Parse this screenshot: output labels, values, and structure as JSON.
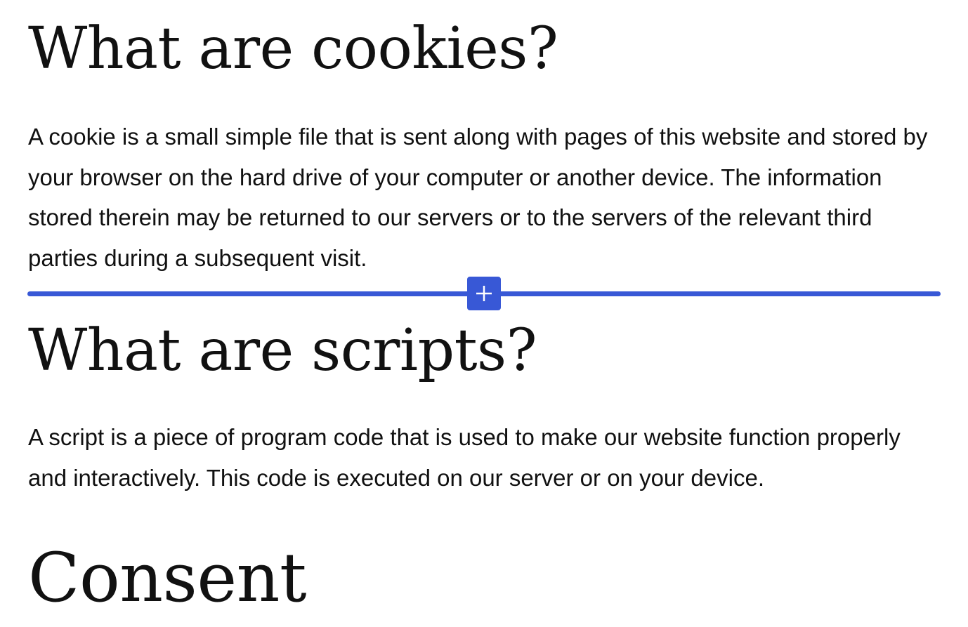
{
  "theme": {
    "accent_color": "#3858d6",
    "text_color": "#111111",
    "background_color": "#ffffff"
  },
  "sections": {
    "cookies": {
      "heading": "What are cookies?",
      "body": "A cookie is a small simple file that is sent along with pages of this website and stored by your browser on the hard drive of your computer or another device. The information stored therein may be returned to our servers or to the servers of the relevant third parties during a subsequent visit."
    },
    "scripts": {
      "heading": "What are scripts?",
      "body": "A script is a piece of program code that is used to make our website function properly and interactively. This code is executed on our server or on your device."
    },
    "consent": {
      "heading": "Consent"
    }
  },
  "block_inserter": {
    "icon": "plus-icon"
  }
}
